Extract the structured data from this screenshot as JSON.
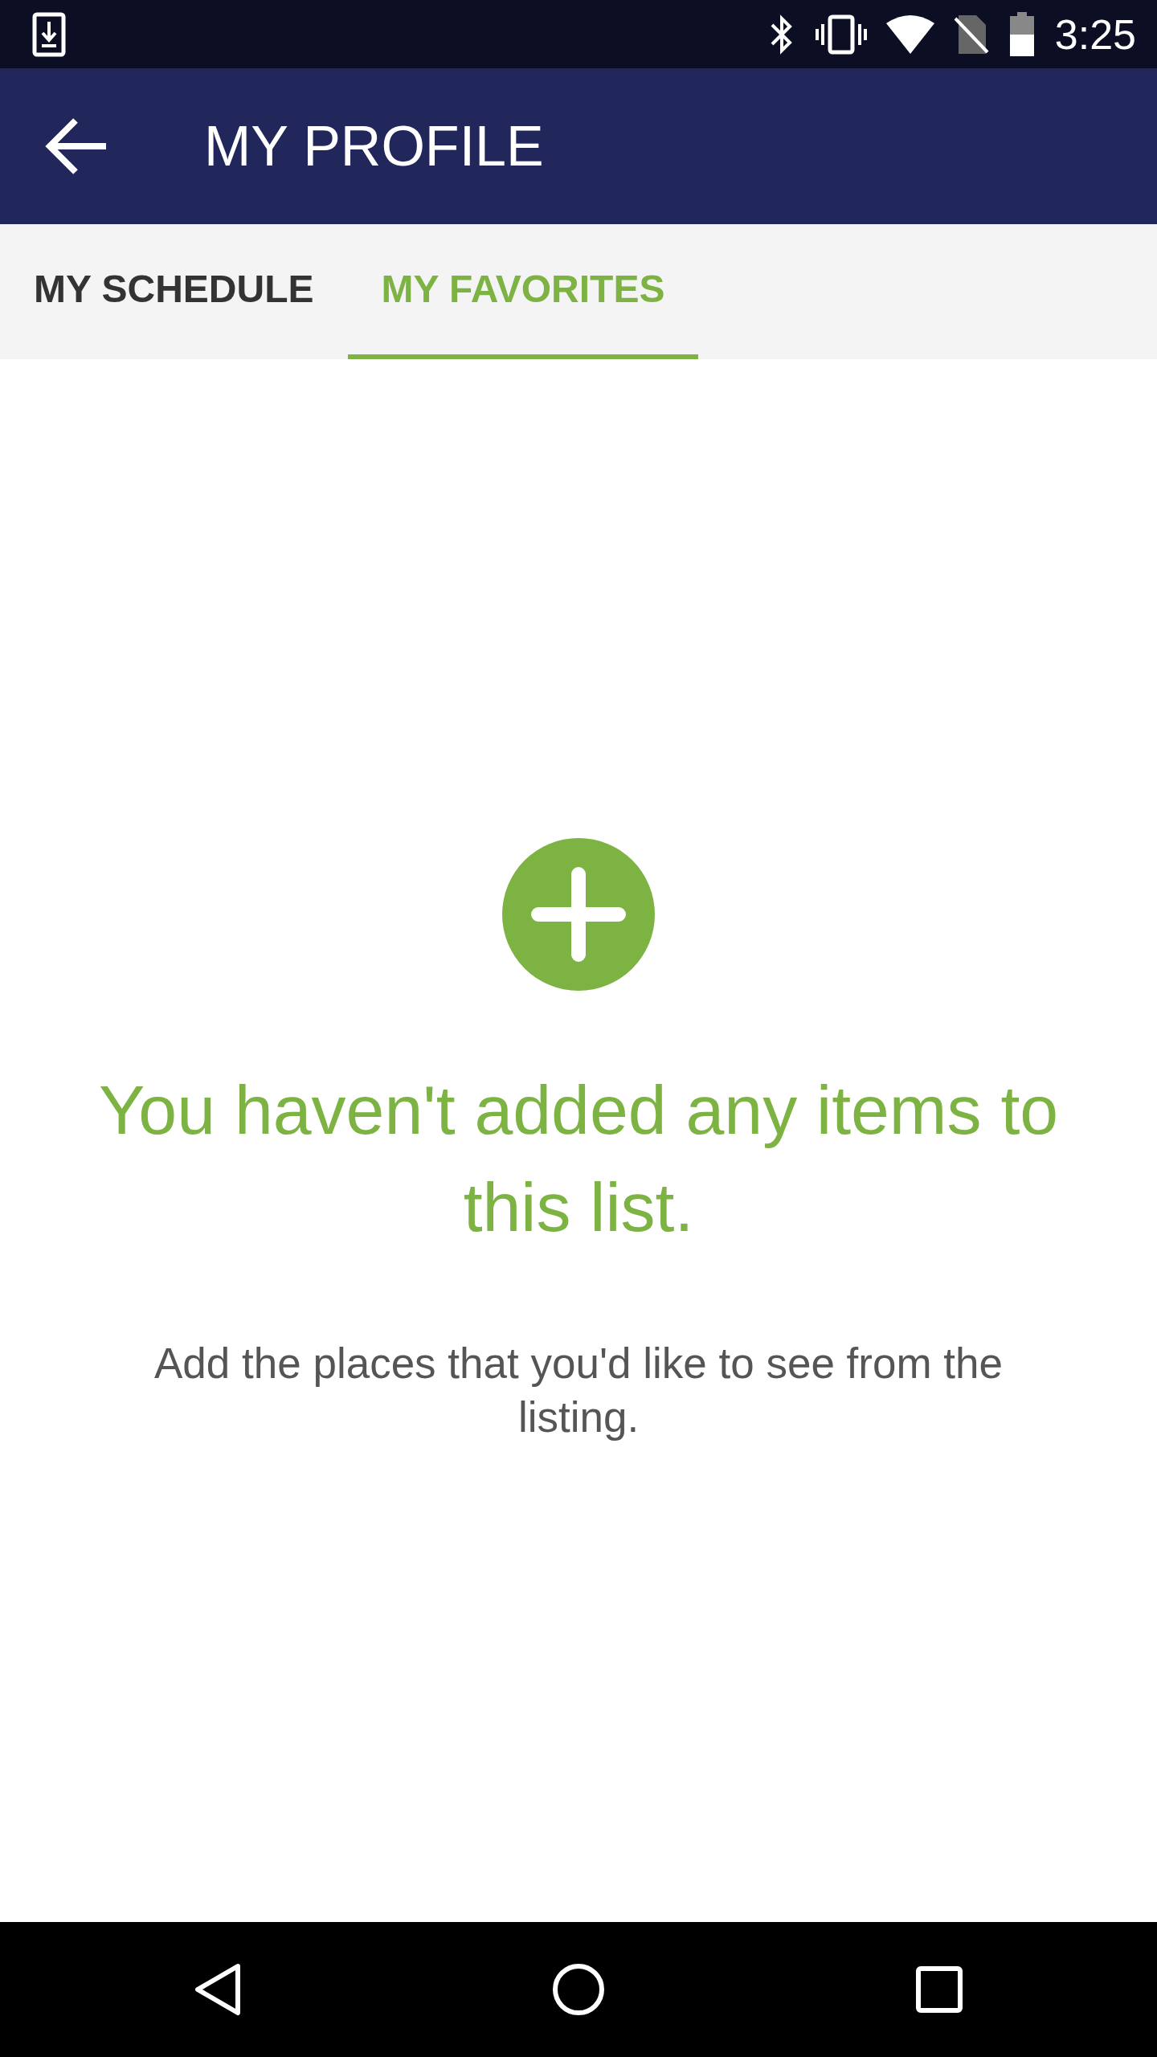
{
  "status_bar": {
    "time": "3:25"
  },
  "app_bar": {
    "title": "MY PROFILE"
  },
  "tabs": [
    {
      "label": "MY SCHEDULE",
      "selected": false
    },
    {
      "label": "MY FAVORITES",
      "selected": true
    }
  ],
  "empty_state": {
    "title": "You haven't added any items to this list.",
    "message": "Add the places that you'd like to see from the listing."
  }
}
